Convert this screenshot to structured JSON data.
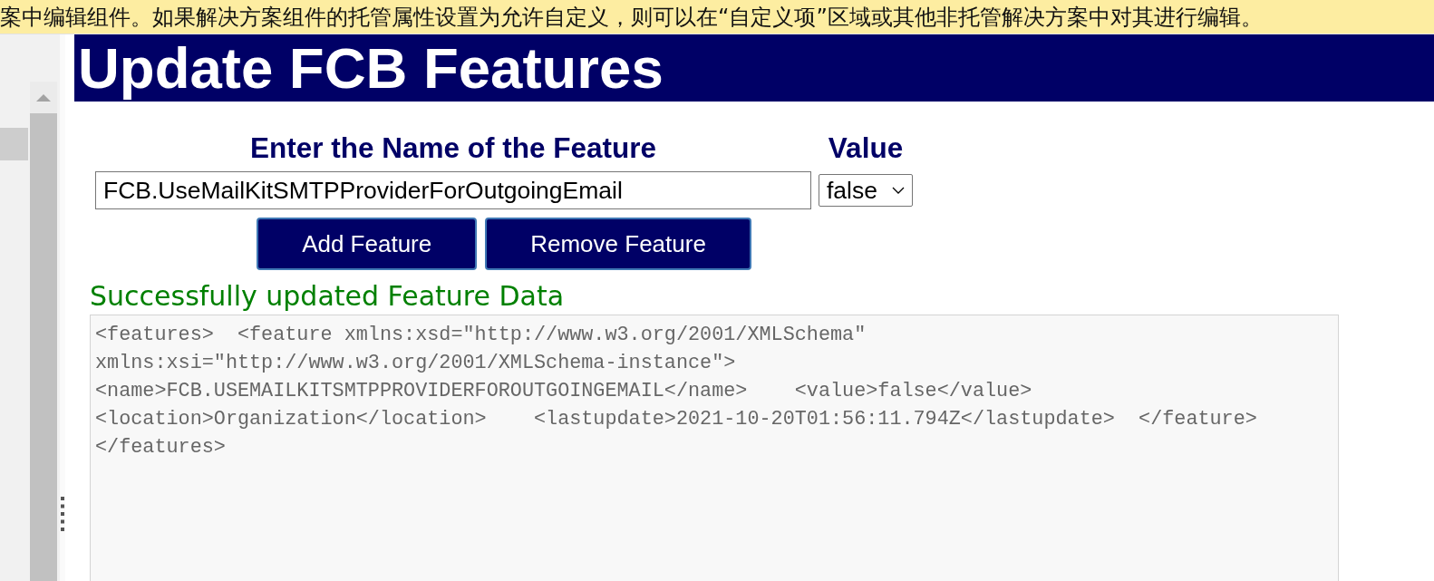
{
  "notice_banner": {
    "text": "案中编辑组件。如果解决方案组件的托管属性设置为允许自定义，则可以在“自定义项”区域或其他非托管解决方案中对其进行编辑。"
  },
  "page": {
    "title": "Update FCB Features"
  },
  "form": {
    "name_label": "Enter the Name of the Feature",
    "value_label": "Value",
    "name_field": {
      "value": "FCB.UseMailKitSMTPProviderForOutgoingEmail"
    },
    "value_select": {
      "value": "false"
    },
    "buttons": [
      "Add Feature",
      "Remove Feature"
    ]
  },
  "status_message": "Successfully updated Feature Data",
  "output": {
    "value": "<features>  <feature xmlns:xsd=\"http://www.w3.org/2001/XMLSchema\"\nxmlns:xsi=\"http://www.w3.org/2001/XMLSchema-instance\">\n<name>FCB.USEMAILKITSMTPPROVIDERFOROUTGOINGEMAIL</name>    <value>false</value>\n<location>Organization</location>    <lastupdate>2021-10-20T01:56:11.794Z</lastupdate>  </feature>\n</features>"
  }
}
